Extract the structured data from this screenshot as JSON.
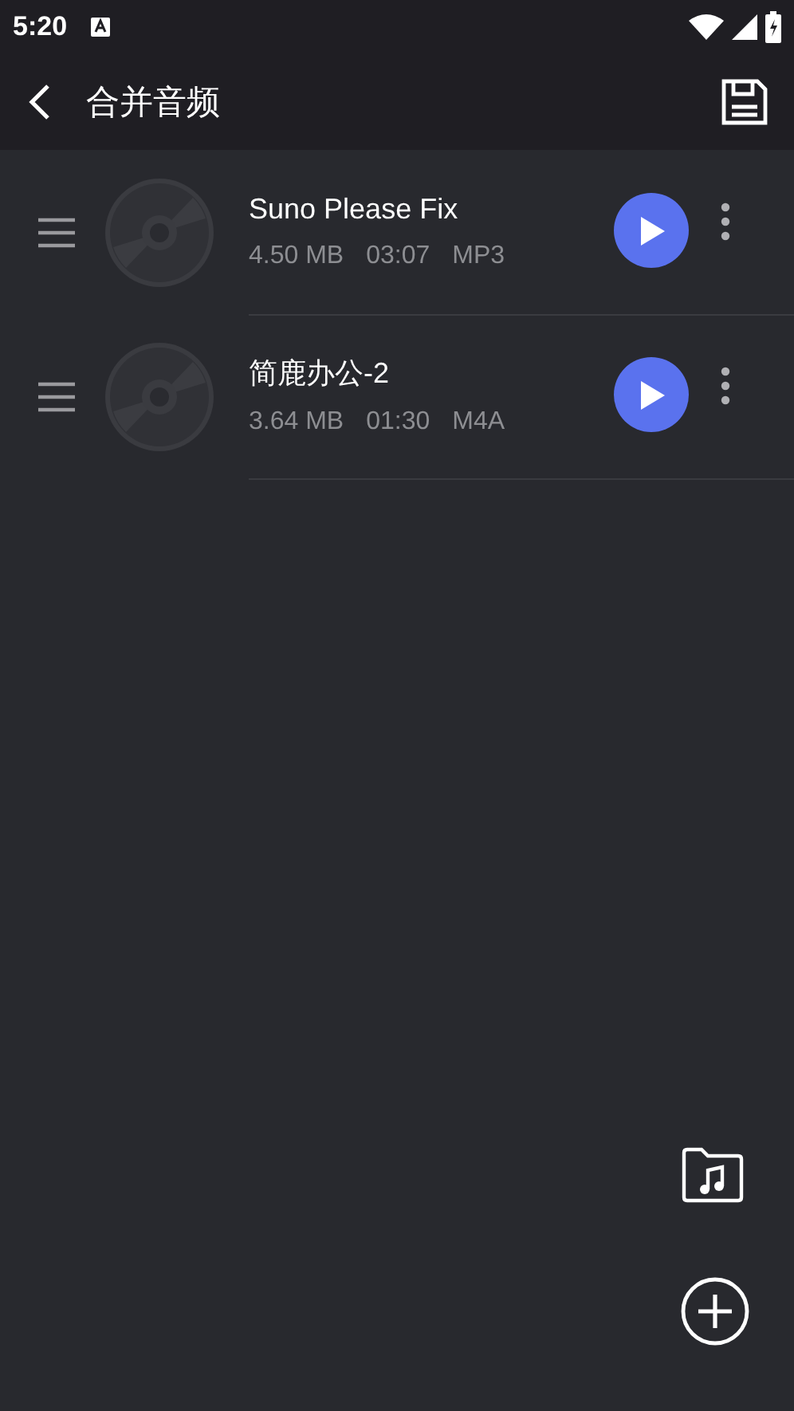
{
  "status_bar": {
    "time": "5:20"
  },
  "app_bar": {
    "title": "合并音频"
  },
  "tracks": [
    {
      "name": "Suno Please Fix",
      "size": "4.50 MB",
      "duration": "03:07",
      "format": "MP3"
    },
    {
      "name": "简鹿办公-2",
      "size": "3.64 MB",
      "duration": "01:30",
      "format": "M4A"
    }
  ]
}
